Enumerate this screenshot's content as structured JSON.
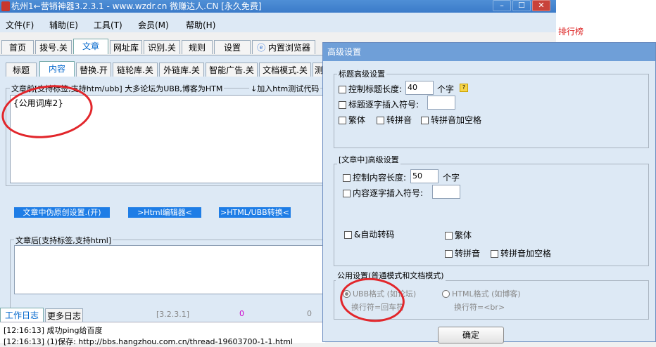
{
  "window": {
    "title": "杭州1←营销神器3.2.3.1 - www.wzdr.cn 微赚达人.CN [永久免费]",
    "minimize": "–",
    "maximize": "☐",
    "close": "✕"
  },
  "menu": [
    "文件(F)",
    "辅助(E)",
    "工具(T)",
    "会员(M)",
    "帮助(H)"
  ],
  "right_panel": {
    "ranking": "排行榜"
  },
  "main_tabs": [
    "首页",
    "拨号.关",
    "文章",
    "网址库",
    "识别.关",
    "规则",
    "设置",
    "内置浏览器"
  ],
  "sub_tabs": [
    "标题",
    "内容",
    "替换.开",
    "链轮库.关",
    "外链库.关",
    "智能广告.关",
    "文档模式.关",
    "测"
  ],
  "article_before": {
    "label": "文章前[支持标签,支持htm/ubb] 大多论坛为UBB,博客为HTM",
    "insert_link": "↓加入htm测试代码",
    "content": "{公用词库2}"
  },
  "buttons": {
    "pseudo_original": "文章中伪原创设置.(开)",
    "html_editor": ">Html编辑器<",
    "html_ubb": ">HTML/UBB转换<"
  },
  "article_after": {
    "label": "文章后[支持标签,支持html]"
  },
  "log": {
    "tabs": [
      "工作日志",
      "更多日志"
    ],
    "version": "[3.2.3.1]",
    "count1": "0",
    "count2": "0",
    "lines": [
      "[12:16:13] 成功ping给百度",
      "[12:16:13] (1)保存: http://bbs.hangzhou.com.cn/thread-19603700-1-1.html"
    ]
  },
  "dialog": {
    "title": "高级设置",
    "title_section": {
      "label": "标题高级设置",
      "limit_length": "控制标题长度:",
      "limit_value": "40",
      "unit": "个字",
      "char_insert": "标题逐字插入符号:",
      "traditional": "繁体",
      "pinyin": "转拼音",
      "pinyin_space": "转拼音加空格"
    },
    "content_section": {
      "label": "[文章中]高级设置",
      "limit_length": "控制内容长度:",
      "limit_value": "50",
      "unit": "个字",
      "char_insert": "内容逐字插入符号:",
      "auto_transcode": "&自动转码",
      "traditional": "繁体",
      "pinyin": "转拼音",
      "pinyin_space": "转拼音加空格"
    },
    "public_section": {
      "label": "公用设置(普通模式和文档模式)",
      "ubb_option": "UBB格式 (如论坛)",
      "ubb_newline": "换行符=回车符",
      "html_option": "HTML格式 (如博客)",
      "html_newline": "换行符=<br>"
    },
    "ok": "确定"
  },
  "colors": {
    "title_bar": "#3b7bc9",
    "panel_bg": "#dde9f5",
    "button_blue": "#1e7de6",
    "annotation_red": "#e2262b",
    "ranking_red": "#d22222"
  }
}
